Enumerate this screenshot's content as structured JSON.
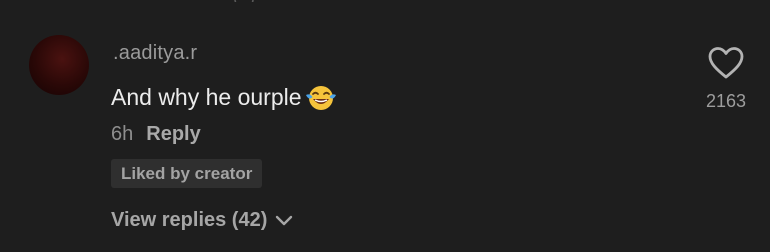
{
  "comment": {
    "username": ".aaditya.r",
    "text": "And why he ourple",
    "emoji": "face-with-tears-of-joy",
    "time": "6h",
    "reply_label": "Reply",
    "liked_badge": "Liked by creator",
    "like_count": "2163",
    "view_replies_label": "View replies (42)"
  },
  "colors": {
    "background": "#1e1e1e",
    "text_primary": "#ececec",
    "text_secondary": "#9b9b9b",
    "badge_bg": "#2f2f2f"
  }
}
